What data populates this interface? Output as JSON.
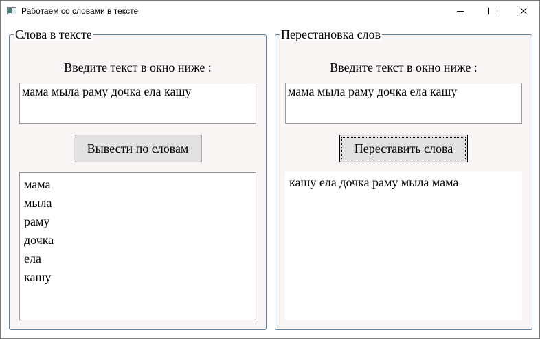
{
  "window": {
    "title": "Работаем со словами в тексте",
    "icons": {
      "app": "app-window-icon",
      "minimize": "minimize-icon",
      "maximize": "maximize-icon",
      "close": "close-icon"
    }
  },
  "left_group": {
    "title": "Слова в тексте",
    "prompt": "Введите текст в окно ниже :",
    "input_value": "мама мыла раму дочка ела кашу",
    "button_label": "Вывести по словам",
    "words": [
      "мама",
      "мыла",
      "раму",
      "дочка",
      "ела",
      "кашу"
    ]
  },
  "right_group": {
    "title": "Перестановка слов",
    "prompt": "Введите текст в окно ниже :",
    "input_value": "мама мыла раму дочка ела кашу",
    "button_label": "Переставить слова",
    "output_text": "кашу ела дочка раму мыла мама"
  }
}
